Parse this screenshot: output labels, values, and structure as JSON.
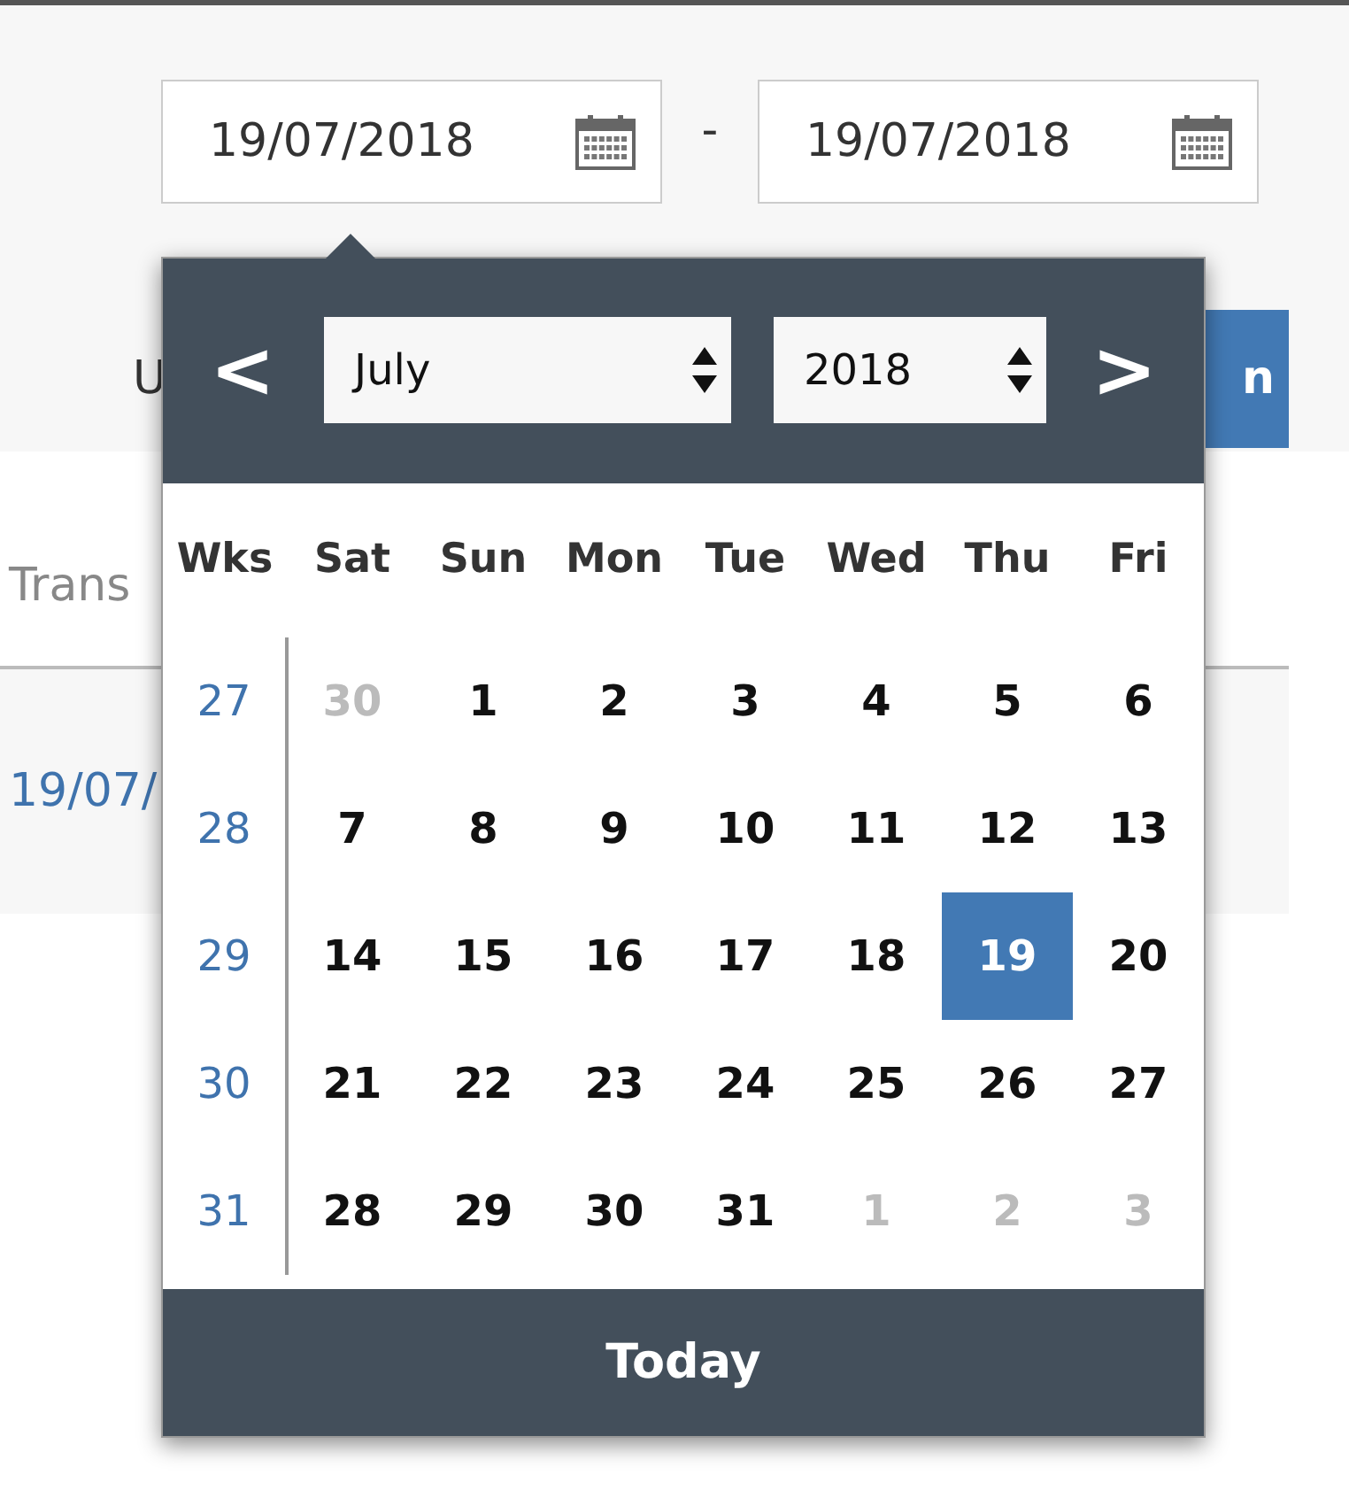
{
  "date_range": {
    "from": "19/07/2018",
    "separator": "-",
    "to": "19/07/2018"
  },
  "background": {
    "label_fragment": "U",
    "button_fragment": "n",
    "column_header": "Trans",
    "row_date": "19/07/"
  },
  "datepicker": {
    "prev": "<",
    "month": "July",
    "year": "2018",
    "next": ">",
    "weekday_header": [
      "Wks",
      "Sat",
      "Sun",
      "Mon",
      "Tue",
      "Wed",
      "Thu",
      "Fri"
    ],
    "weeks": [
      {
        "week": "27",
        "days": [
          {
            "label": "30",
            "muted": true,
            "selected": false
          },
          {
            "label": "1",
            "muted": false,
            "selected": false
          },
          {
            "label": "2",
            "muted": false,
            "selected": false
          },
          {
            "label": "3",
            "muted": false,
            "selected": false
          },
          {
            "label": "4",
            "muted": false,
            "selected": false
          },
          {
            "label": "5",
            "muted": false,
            "selected": false
          },
          {
            "label": "6",
            "muted": false,
            "selected": false
          }
        ]
      },
      {
        "week": "28",
        "days": [
          {
            "label": "7",
            "muted": false,
            "selected": false
          },
          {
            "label": "8",
            "muted": false,
            "selected": false
          },
          {
            "label": "9",
            "muted": false,
            "selected": false
          },
          {
            "label": "10",
            "muted": false,
            "selected": false
          },
          {
            "label": "11",
            "muted": false,
            "selected": false
          },
          {
            "label": "12",
            "muted": false,
            "selected": false
          },
          {
            "label": "13",
            "muted": false,
            "selected": false
          }
        ]
      },
      {
        "week": "29",
        "days": [
          {
            "label": "14",
            "muted": false,
            "selected": false
          },
          {
            "label": "15",
            "muted": false,
            "selected": false
          },
          {
            "label": "16",
            "muted": false,
            "selected": false
          },
          {
            "label": "17",
            "muted": false,
            "selected": false
          },
          {
            "label": "18",
            "muted": false,
            "selected": false
          },
          {
            "label": "19",
            "muted": false,
            "selected": true
          },
          {
            "label": "20",
            "muted": false,
            "selected": false
          }
        ]
      },
      {
        "week": "30",
        "days": [
          {
            "label": "21",
            "muted": false,
            "selected": false
          },
          {
            "label": "22",
            "muted": false,
            "selected": false
          },
          {
            "label": "23",
            "muted": false,
            "selected": false
          },
          {
            "label": "24",
            "muted": false,
            "selected": false
          },
          {
            "label": "25",
            "muted": false,
            "selected": false
          },
          {
            "label": "26",
            "muted": false,
            "selected": false
          },
          {
            "label": "27",
            "muted": false,
            "selected": false
          }
        ]
      },
      {
        "week": "31",
        "days": [
          {
            "label": "28",
            "muted": false,
            "selected": false
          },
          {
            "label": "29",
            "muted": false,
            "selected": false
          },
          {
            "label": "30",
            "muted": false,
            "selected": false
          },
          {
            "label": "31",
            "muted": false,
            "selected": false
          },
          {
            "label": "1",
            "muted": true,
            "selected": false
          },
          {
            "label": "2",
            "muted": true,
            "selected": false
          },
          {
            "label": "3",
            "muted": true,
            "selected": false
          }
        ]
      }
    ],
    "today": "Today"
  }
}
